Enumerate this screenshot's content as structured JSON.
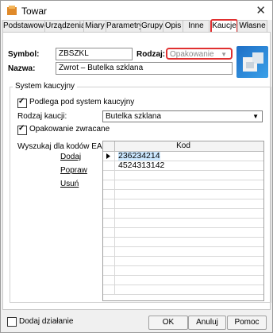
{
  "window": {
    "title": "Towar",
    "close_glyph": "✕"
  },
  "tabs": [
    {
      "label": "Podstawowe"
    },
    {
      "label": "Urządzenia"
    },
    {
      "label": "Miary"
    },
    {
      "label": "Parametry"
    },
    {
      "label": "Grupy"
    },
    {
      "label": "Opis"
    },
    {
      "label": "Inne"
    },
    {
      "label": "Kaucje",
      "active": true
    },
    {
      "label": "Własne"
    }
  ],
  "form": {
    "symbol_label": "Symbol:",
    "symbol_value": "ZBSZKL",
    "rodzaj_label": "Rodzaj:",
    "rodzaj_value": "Opakowanie",
    "nazwa_label": "Nazwa:",
    "nazwa_value": "Zwrot – Butelka szklana"
  },
  "group": {
    "title": "System kaucyjny",
    "podlega_label": "Podlega pod system kaucyjny",
    "rodzaj_kaucji_label": "Rodzaj kaucji:",
    "rodzaj_kaucji_value": "Butelka szklana",
    "opakowanie_label": "Opakowanie zwracane",
    "ean_label": "Wyszukaj dla kodów EAN:",
    "actions": {
      "dodaj": "Dodaj",
      "popraw": "Popraw",
      "usun": "Usuń"
    }
  },
  "grid": {
    "header": "Kod",
    "rows": [
      "236234214",
      "4524313142"
    ]
  },
  "footer": {
    "dodaj_dzialanie": "Dodaj działanie",
    "ok": "OK",
    "anuluj": "Anuluj",
    "pomoc": "Pomoc"
  },
  "colors": {
    "highlight": "#e03030",
    "selection": "#cce8ff"
  }
}
